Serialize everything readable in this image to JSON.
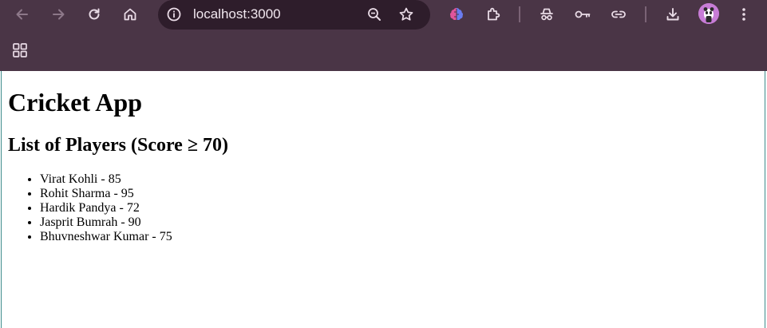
{
  "browser": {
    "url": "localhost:3000",
    "colors": {
      "frame": "#4a3546",
      "omnibox": "#2e1d2b",
      "icon": "#e9dbe6",
      "icon_disabled": "#8d7889",
      "avatar": "#c77cd6"
    },
    "icons": [
      "back-icon",
      "forward-icon",
      "reload-icon",
      "home-icon",
      "site-info-icon",
      "zoom-icon",
      "bookmark-star-icon",
      "extension-ai-icon",
      "extensions-puzzle-icon",
      "incognito-spy-icon",
      "password-key-icon",
      "link-icon",
      "download-icon",
      "profile-avatar",
      "more-menu-icon",
      "apps-grid-icon"
    ]
  },
  "page": {
    "title": "Cricket App",
    "subtitle": "List of Players (Score ≥ 70)",
    "players": [
      {
        "text": "Virat Kohli - 85"
      },
      {
        "text": "Rohit Sharma - 95"
      },
      {
        "text": "Hardik Pandya - 72"
      },
      {
        "text": "Jasprit Bumrah - 90"
      },
      {
        "text": "Bhuvneshwar Kumar - 75"
      }
    ]
  }
}
